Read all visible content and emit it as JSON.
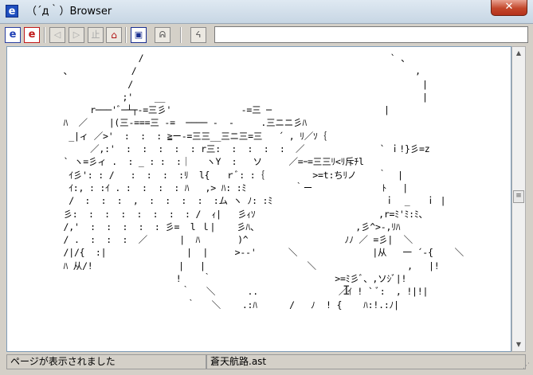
{
  "window": {
    "title": "（´д｀）Browser",
    "app_icon": "e",
    "close_glyph": "✕"
  },
  "toolbar": {
    "buttons": [
      {
        "icon": "e-blue-icon",
        "glyph": "e"
      },
      {
        "icon": "e-red-icon",
        "glyph": "e"
      },
      {
        "icon": "back-icon",
        "glyph": "◁"
      },
      {
        "icon": "forward-icon",
        "glyph": "▷"
      },
      {
        "icon": "stop-icon",
        "glyph": "止"
      },
      {
        "icon": "home-icon",
        "glyph": "⌂"
      },
      {
        "icon": "window-icon",
        "glyph": "▣"
      },
      {
        "icon": "face-icon",
        "glyph": "ᕱ"
      },
      {
        "icon": "ascii-face-icon",
        "glyph": "ᔦ"
      }
    ],
    "url": ""
  },
  "content": {
    "ascii_art": "                       /                                              ` 、\n         、           /                                                    ,\n                     /                                                      |\n                    ;'    __                                                |\n              r───'ﾞ─┴┬‐=三彡'             ‐=三 ─                     |\n         ﾊ  ／    |(三‐===三 ‐=  ──── -  ‐     .三ニニ彡ﾊ\n          _|ィ ／>'  :  :  : ≧ー-=三三__三ニ三=三   ´ , ﾘ／ｿ｛\n              ／,:'  :  :  :  :  : r三:  :  :  :  :  ／              ` ｉ!}彡=z\n         ` ヽ=彡ィ .  : _ : :  :｜   ヽY  :   ソ     ／=ｰ=三三ﾘ<ﾘ斥ﾁl\n          ｲ彡': : /   :  :  :  :ﾘ  l{   ｒﾞ: :｛         >=t:ちﾘノ    ｀  |\n          ｲ:, : :ｲ . :  :  :  : ﾊ   ,> ﾊ: :ﾐ         ｀ー             ﾄ   |\n          /  :  :  :  ,  :  :  :  :  :ム ヽ ﾉ: :ﾐ                     ｉ  _   ｉ |\n         彡:  :  :  :  :  :  :  : /  ｨ|   彡ｨｿ                       ,r=ﾐ'ﾐ:ﾐ、\n         /,'  :  :  :  :  : 彡=  l ｌ|    彡ﾊ、                  ,彡^>-,ﾘﾊ\n         / .  :  :  :  ／      |  ﾊ       )^                  ﾉﾉ ／ =彡|  ＼\n         /|/{  :|               |  |     >‐‐'      ＼              |从   一 ´-{    ＼\n         ﾊ 从/!                |   |                   ＼                 ,   |!\n                              !    ｀                       >=ﾐ彡ﾞ、,ソｼﾞ|!\n                               ｀   ＼      ..               ／ｲ ! ` ﾞ:  , !|!|\n                                ｀   ＼    .:ﾊ      /   ﾉ  ! {    ﾊ:!.:ﾉ|"
  },
  "status": {
    "left": "ページが表示されました",
    "right": "蒼天航路.ast"
  }
}
